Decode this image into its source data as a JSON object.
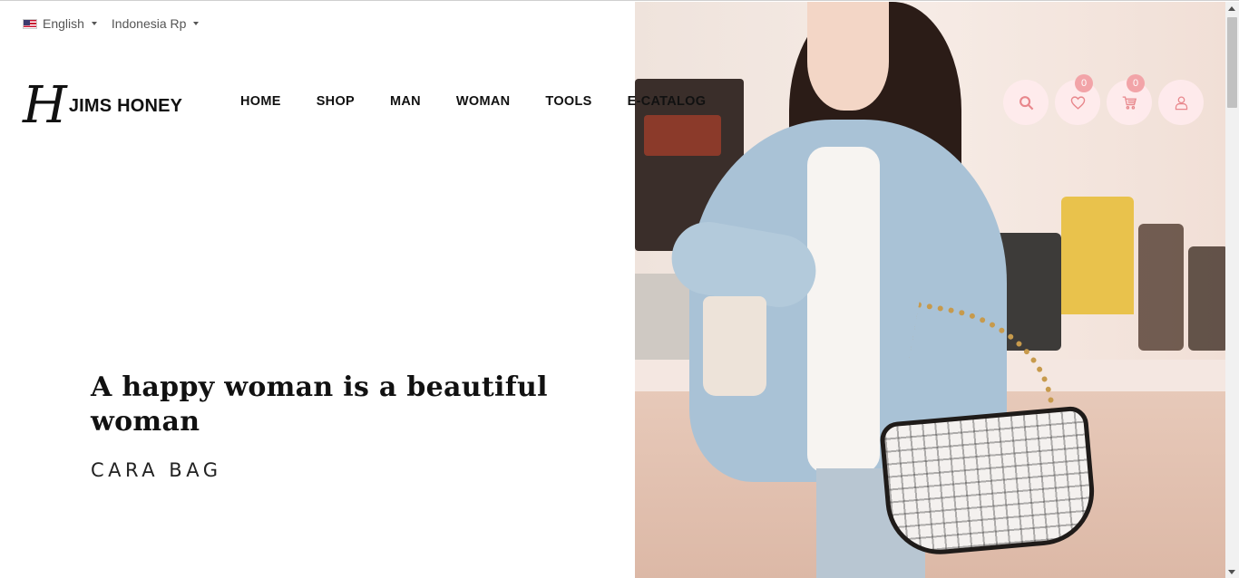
{
  "topbar": {
    "language": "English",
    "currency": "Indonesia Rp",
    "flag_icon": "us-flag-icon"
  },
  "brand": {
    "logo_mark": "H",
    "name": "JIMS HONEY"
  },
  "nav": {
    "items": [
      {
        "label": "HOME"
      },
      {
        "label": "SHOP"
      },
      {
        "label": "MAN"
      },
      {
        "label": "WOMAN"
      },
      {
        "label": "TOOLS"
      },
      {
        "label": "E-CATALOG"
      }
    ]
  },
  "actions": {
    "search_icon": "search-icon",
    "wishlist_icon": "heart-icon",
    "wishlist_count": "0",
    "cart_icon": "cart-icon",
    "cart_count": "0",
    "account_icon": "user-icon"
  },
  "hero": {
    "title": "A happy woman is a beautiful woman",
    "subtitle": "CARA BAG"
  },
  "colors": {
    "accent": "#f2a4a8",
    "icon": "#e8878c",
    "icon_bg": "#ffebed"
  }
}
